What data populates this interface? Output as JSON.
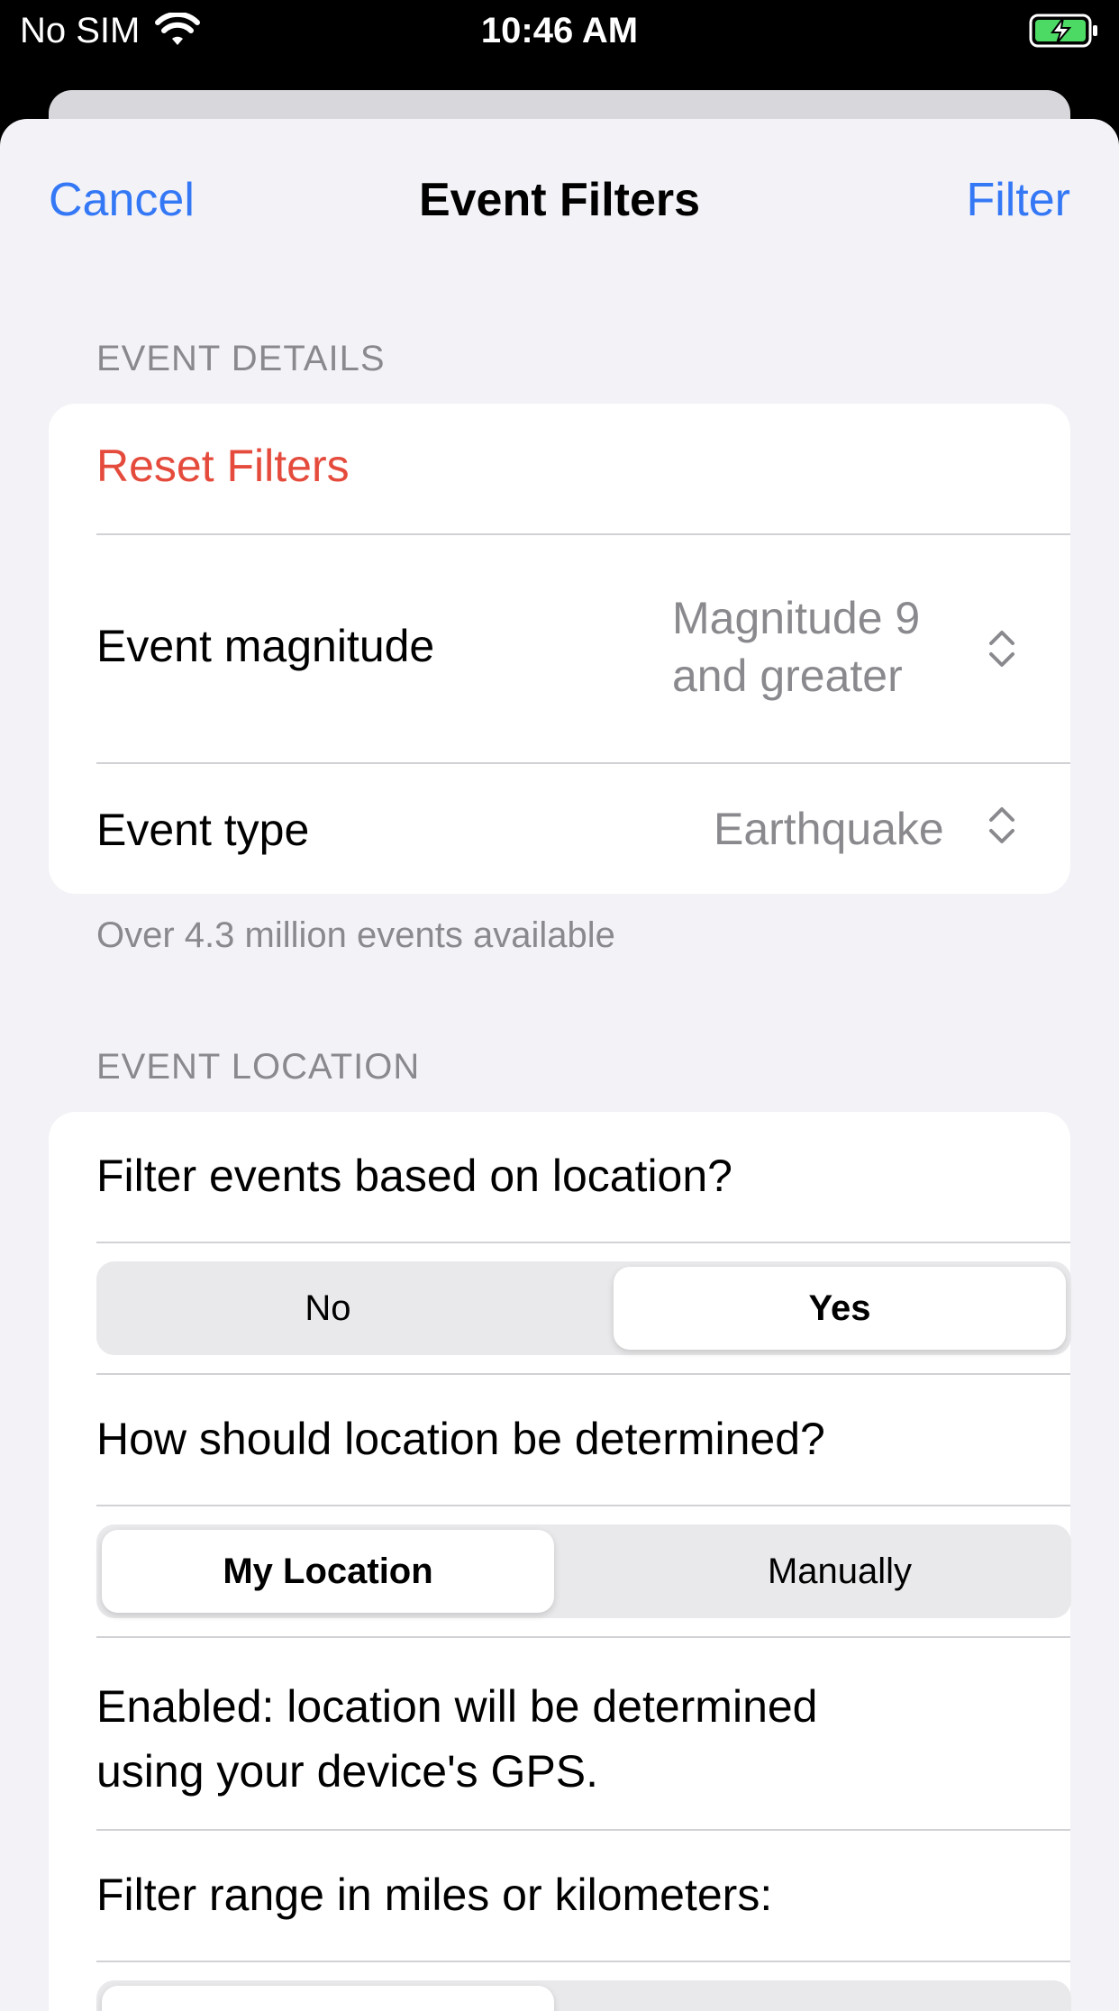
{
  "status_bar": {
    "carrier": "No SIM",
    "time": "10:46 AM"
  },
  "nav": {
    "cancel": "Cancel",
    "title": "Event Filters",
    "filter": "Filter"
  },
  "event_details": {
    "header": "EVENT DETAILS",
    "reset": "Reset Filters",
    "magnitude_label": "Event magnitude",
    "magnitude_value_line1": "Magnitude 9",
    "magnitude_value_line2": "and greater",
    "type_label": "Event type",
    "type_value": "Earthquake",
    "footer": "Over 4.3 million events available"
  },
  "event_location": {
    "header": "EVENT LOCATION",
    "filter_question": "Filter events based on location?",
    "filter_options": [
      "No",
      "Yes"
    ],
    "filter_selected": "Yes",
    "method_question": "How should location be determined?",
    "method_options": [
      "My Location",
      "Manually"
    ],
    "method_selected": "My Location",
    "enabled_line1": "Enabled: location will be determined",
    "enabled_line2": "using your device's GPS.",
    "range_question": "Filter range in miles or kilometers:"
  },
  "colors": {
    "accent": "#3478f6",
    "destructive": "#e54b3c",
    "secondary_text": "#8a8a8e",
    "background": "#f2f2f7"
  }
}
